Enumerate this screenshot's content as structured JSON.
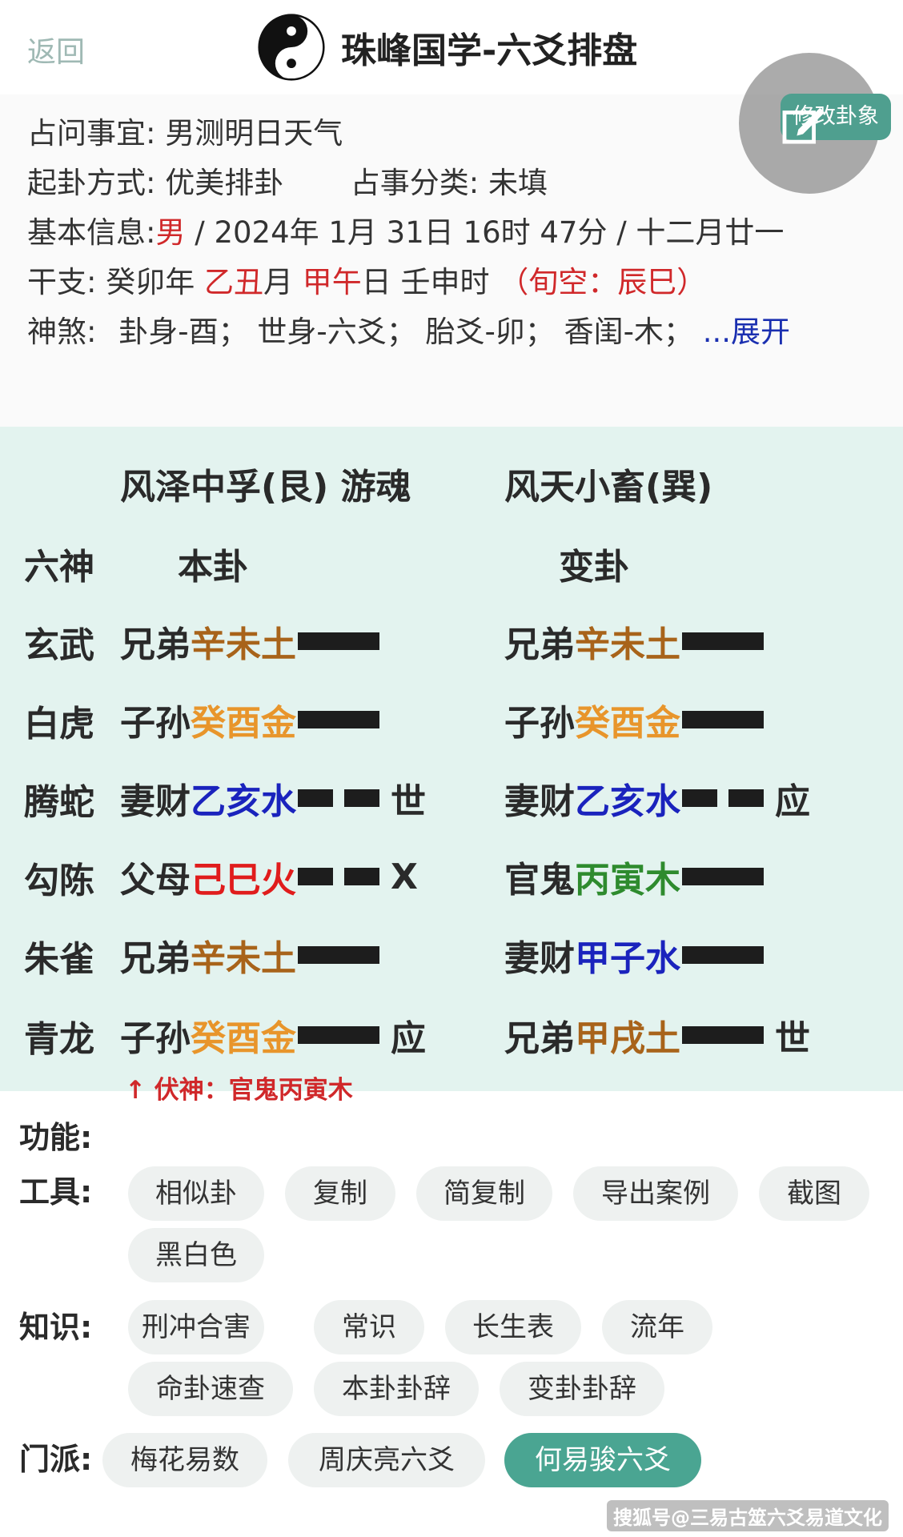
{
  "header": {
    "back_label": "返回",
    "title": "珠峰国学-六爻排盘"
  },
  "info": {
    "question_label": "占问事宜:",
    "question_value": "男测明日天气",
    "method_label": "起卦方式:",
    "method_value": "优美排卦",
    "category_label": "占事分类:",
    "category_value": "未填",
    "basic_label": "基本信息:",
    "basic_gender": "男",
    "basic_rest": " / 2024年 1月 31日 16时 47分 / 十二月廿一",
    "ganzhi_label": "干支:",
    "ganzhi_year": "癸卯年",
    "ganzhi_month_stem": "乙丑",
    "ganzhi_month_suffix": "月",
    "ganzhi_day_stem": "甲午",
    "ganzhi_day_suffix": "日",
    "ganzhi_hour": "壬申时",
    "xunkong": "（旬空：辰巳）",
    "shensha_label": "神煞:",
    "shensha_items": "卦身-酉；  世身-六爻；  胎爻-卯；  香闺-木；",
    "expand_label": "...展开"
  },
  "float_button": {
    "label": "修改卦象"
  },
  "hexagram": {
    "ben_name": "风泽中孚(艮) 游魂",
    "bian_name": "风天小畜(巽)",
    "col_god": "六神",
    "col_ben": "本卦",
    "col_bian": "变卦",
    "rows": [
      {
        "god": "玄武",
        "ben_rel": "兄弟",
        "ben_stem": "辛未土",
        "ben_el": "earth",
        "ben_line": "yang",
        "ben_mark": "",
        "bian_rel": "兄弟",
        "bian_stem": "辛未土",
        "bian_el": "earth",
        "bian_line": "yang",
        "bian_mark": ""
      },
      {
        "god": "白虎",
        "ben_rel": "子孙",
        "ben_stem": "癸酉金",
        "ben_el": "metal",
        "ben_line": "yang",
        "ben_mark": "",
        "bian_rel": "子孙",
        "bian_stem": "癸酉金",
        "bian_el": "metal",
        "bian_line": "yang",
        "bian_mark": ""
      },
      {
        "god": "腾蛇",
        "ben_rel": "妻财",
        "ben_stem": "乙亥水",
        "ben_el": "water",
        "ben_line": "yin",
        "ben_mark": "世",
        "bian_rel": "妻财",
        "bian_stem": "乙亥水",
        "bian_el": "water",
        "bian_line": "yin",
        "bian_mark": "应"
      },
      {
        "god": "勾陈",
        "ben_rel": "父母",
        "ben_stem": "己巳火",
        "ben_el": "fire",
        "ben_line": "yin",
        "ben_mark": "X",
        "bian_rel": "官鬼",
        "bian_stem": "丙寅木",
        "bian_el": "wood",
        "bian_line": "yang",
        "bian_mark": ""
      },
      {
        "god": "朱雀",
        "ben_rel": "兄弟",
        "ben_stem": "辛未土",
        "ben_el": "earth",
        "ben_line": "yang",
        "ben_mark": "",
        "bian_rel": "妻财",
        "bian_stem": "甲子水",
        "bian_el": "water",
        "bian_line": "yang",
        "bian_mark": ""
      },
      {
        "god": "青龙",
        "ben_rel": "子孙",
        "ben_stem": "癸酉金",
        "ben_el": "metal",
        "ben_line": "yang",
        "ben_mark": "应",
        "bian_rel": "兄弟",
        "bian_stem": "甲戌土",
        "bian_el": "earth",
        "bian_line": "yang",
        "bian_mark": "世"
      }
    ],
    "fushen": "↑ 伏神：官鬼丙寅木"
  },
  "functions": {
    "section_label": "功能:",
    "tools_label": "工具:",
    "tools": [
      "相似卦",
      "复制",
      "简复制",
      "导出案例",
      "截图",
      "黑白色"
    ],
    "knowledge_label": "知识:",
    "knowledge": [
      "刑冲合害",
      "常识",
      "长生表",
      "流年",
      "命卦速查",
      "本卦卦辞",
      "变卦卦辞"
    ],
    "school_label": "门派:",
    "schools": [
      "梅花易数",
      "周庆亮六爻",
      "何易骏六爻"
    ],
    "active_school": "何易骏六爻"
  },
  "footer": {
    "watermark": "搜狐号@三易古筮六爻易道文化"
  }
}
